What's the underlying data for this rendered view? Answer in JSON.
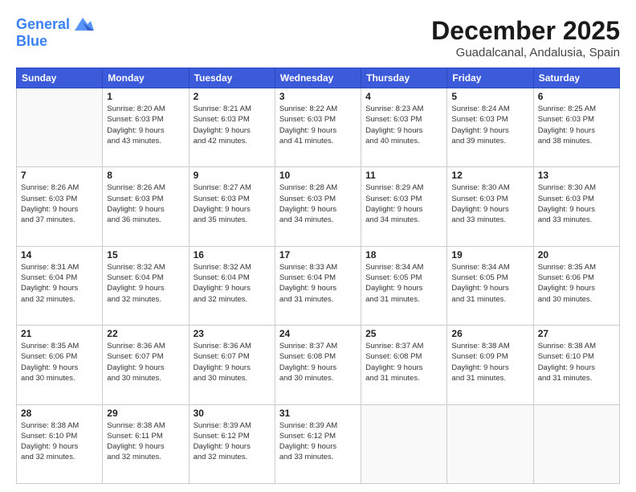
{
  "logo": {
    "line1": "General",
    "line2": "Blue"
  },
  "title": "December 2025",
  "location": "Guadalcanal, Andalusia, Spain",
  "weekdays": [
    "Sunday",
    "Monday",
    "Tuesday",
    "Wednesday",
    "Thursday",
    "Friday",
    "Saturday"
  ],
  "weeks": [
    [
      {
        "day": "",
        "info": ""
      },
      {
        "day": "1",
        "info": "Sunrise: 8:20 AM\nSunset: 6:03 PM\nDaylight: 9 hours\nand 43 minutes."
      },
      {
        "day": "2",
        "info": "Sunrise: 8:21 AM\nSunset: 6:03 PM\nDaylight: 9 hours\nand 42 minutes."
      },
      {
        "day": "3",
        "info": "Sunrise: 8:22 AM\nSunset: 6:03 PM\nDaylight: 9 hours\nand 41 minutes."
      },
      {
        "day": "4",
        "info": "Sunrise: 8:23 AM\nSunset: 6:03 PM\nDaylight: 9 hours\nand 40 minutes."
      },
      {
        "day": "5",
        "info": "Sunrise: 8:24 AM\nSunset: 6:03 PM\nDaylight: 9 hours\nand 39 minutes."
      },
      {
        "day": "6",
        "info": "Sunrise: 8:25 AM\nSunset: 6:03 PM\nDaylight: 9 hours\nand 38 minutes."
      }
    ],
    [
      {
        "day": "7",
        "info": "Sunrise: 8:26 AM\nSunset: 6:03 PM\nDaylight: 9 hours\nand 37 minutes."
      },
      {
        "day": "8",
        "info": "Sunrise: 8:26 AM\nSunset: 6:03 PM\nDaylight: 9 hours\nand 36 minutes."
      },
      {
        "day": "9",
        "info": "Sunrise: 8:27 AM\nSunset: 6:03 PM\nDaylight: 9 hours\nand 35 minutes."
      },
      {
        "day": "10",
        "info": "Sunrise: 8:28 AM\nSunset: 6:03 PM\nDaylight: 9 hours\nand 34 minutes."
      },
      {
        "day": "11",
        "info": "Sunrise: 8:29 AM\nSunset: 6:03 PM\nDaylight: 9 hours\nand 34 minutes."
      },
      {
        "day": "12",
        "info": "Sunrise: 8:30 AM\nSunset: 6:03 PM\nDaylight: 9 hours\nand 33 minutes."
      },
      {
        "day": "13",
        "info": "Sunrise: 8:30 AM\nSunset: 6:03 PM\nDaylight: 9 hours\nand 33 minutes."
      }
    ],
    [
      {
        "day": "14",
        "info": "Sunrise: 8:31 AM\nSunset: 6:04 PM\nDaylight: 9 hours\nand 32 minutes."
      },
      {
        "day": "15",
        "info": "Sunrise: 8:32 AM\nSunset: 6:04 PM\nDaylight: 9 hours\nand 32 minutes."
      },
      {
        "day": "16",
        "info": "Sunrise: 8:32 AM\nSunset: 6:04 PM\nDaylight: 9 hours\nand 32 minutes."
      },
      {
        "day": "17",
        "info": "Sunrise: 8:33 AM\nSunset: 6:04 PM\nDaylight: 9 hours\nand 31 minutes."
      },
      {
        "day": "18",
        "info": "Sunrise: 8:34 AM\nSunset: 6:05 PM\nDaylight: 9 hours\nand 31 minutes."
      },
      {
        "day": "19",
        "info": "Sunrise: 8:34 AM\nSunset: 6:05 PM\nDaylight: 9 hours\nand 31 minutes."
      },
      {
        "day": "20",
        "info": "Sunrise: 8:35 AM\nSunset: 6:06 PM\nDaylight: 9 hours\nand 30 minutes."
      }
    ],
    [
      {
        "day": "21",
        "info": "Sunrise: 8:35 AM\nSunset: 6:06 PM\nDaylight: 9 hours\nand 30 minutes."
      },
      {
        "day": "22",
        "info": "Sunrise: 8:36 AM\nSunset: 6:07 PM\nDaylight: 9 hours\nand 30 minutes."
      },
      {
        "day": "23",
        "info": "Sunrise: 8:36 AM\nSunset: 6:07 PM\nDaylight: 9 hours\nand 30 minutes."
      },
      {
        "day": "24",
        "info": "Sunrise: 8:37 AM\nSunset: 6:08 PM\nDaylight: 9 hours\nand 30 minutes."
      },
      {
        "day": "25",
        "info": "Sunrise: 8:37 AM\nSunset: 6:08 PM\nDaylight: 9 hours\nand 31 minutes."
      },
      {
        "day": "26",
        "info": "Sunrise: 8:38 AM\nSunset: 6:09 PM\nDaylight: 9 hours\nand 31 minutes."
      },
      {
        "day": "27",
        "info": "Sunrise: 8:38 AM\nSunset: 6:10 PM\nDaylight: 9 hours\nand 31 minutes."
      }
    ],
    [
      {
        "day": "28",
        "info": "Sunrise: 8:38 AM\nSunset: 6:10 PM\nDaylight: 9 hours\nand 32 minutes."
      },
      {
        "day": "29",
        "info": "Sunrise: 8:38 AM\nSunset: 6:11 PM\nDaylight: 9 hours\nand 32 minutes."
      },
      {
        "day": "30",
        "info": "Sunrise: 8:39 AM\nSunset: 6:12 PM\nDaylight: 9 hours\nand 32 minutes."
      },
      {
        "day": "31",
        "info": "Sunrise: 8:39 AM\nSunset: 6:12 PM\nDaylight: 9 hours\nand 33 minutes."
      },
      {
        "day": "",
        "info": ""
      },
      {
        "day": "",
        "info": ""
      },
      {
        "day": "",
        "info": ""
      }
    ]
  ]
}
